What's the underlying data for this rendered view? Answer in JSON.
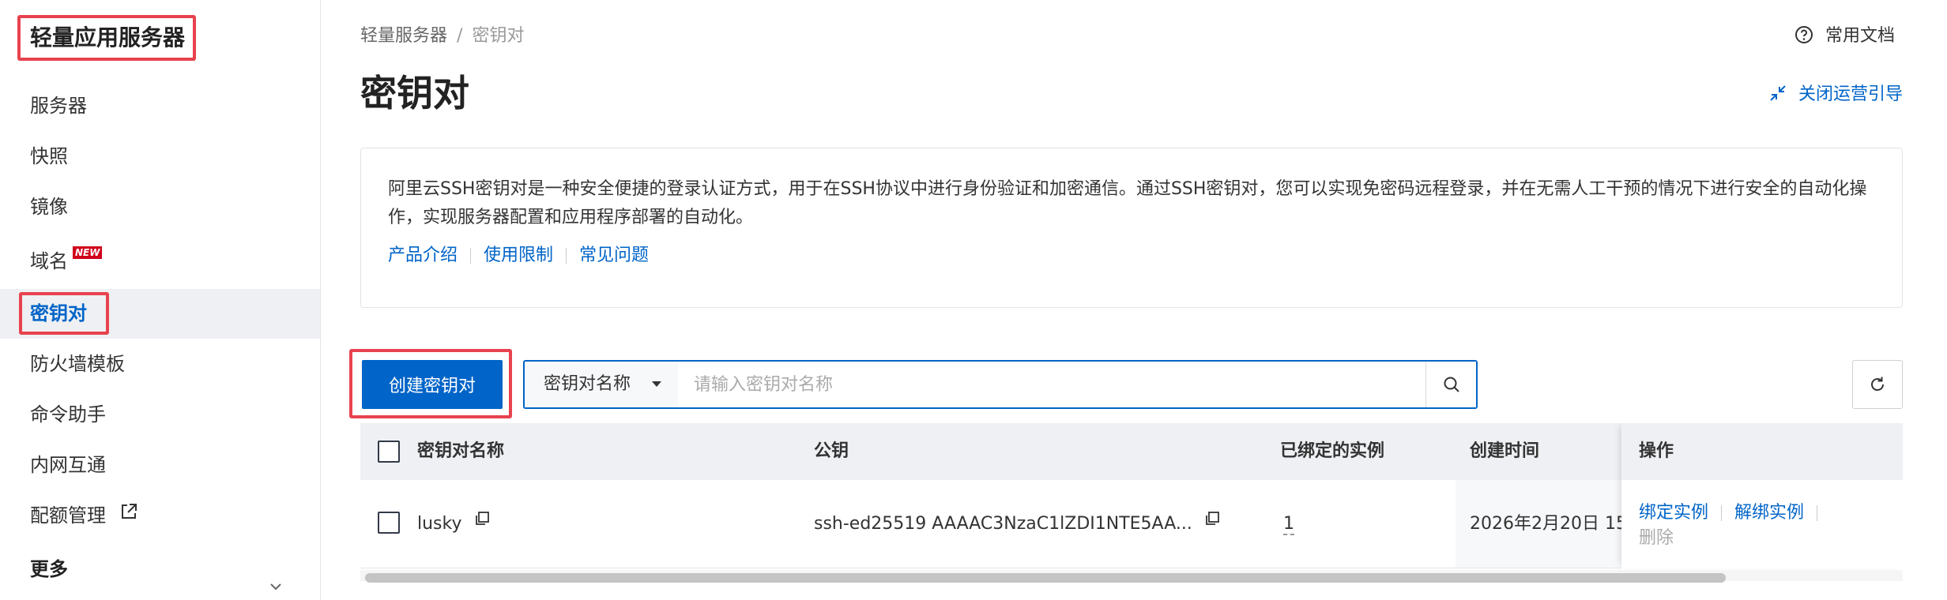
{
  "sidebar": {
    "title": "轻量应用服务器",
    "items": [
      {
        "label": "服务器"
      },
      {
        "label": "快照"
      },
      {
        "label": "镜像"
      },
      {
        "label": "域名",
        "badge": "NEW"
      },
      {
        "label": "密钥对"
      },
      {
        "label": "防火墙模板"
      },
      {
        "label": "命令助手"
      },
      {
        "label": "内网互通"
      },
      {
        "label": "配额管理"
      },
      {
        "label": "更多"
      }
    ]
  },
  "header": {
    "breadcrumb": {
      "parent": "轻量服务器",
      "separator": "/",
      "current": "密钥对"
    },
    "help_label": "常用文档",
    "title": "密钥对",
    "guide_label": "关闭运营引导"
  },
  "intro": {
    "text": "阿里云SSH密钥对是一种安全便捷的登录认证方式，用于在SSH协议中进行身份验证和加密通信。通过SSH密钥对，您可以实现免密码远程登录，并在无需人工干预的情况下进行安全的自动化操作，实现服务器配置和应用程序部署的自动化。",
    "links": [
      "产品介绍",
      "使用限制",
      "常见问题"
    ]
  },
  "toolbar": {
    "create_label": "创建密钥对",
    "search_field": "密钥对名称",
    "search_placeholder": "请输入密钥对名称"
  },
  "table": {
    "headers": {
      "name": "密钥对名称",
      "public_key": "公钥",
      "bound": "已绑定的实例",
      "created": "创建时间",
      "ops": "操作"
    },
    "rows": [
      {
        "name": "lusky",
        "public_key": "ssh-ed25519 AAAAC3NzaC1lZDI1NTE5AA...",
        "bound": "1",
        "created": "2026年2月20日 15",
        "ops": {
          "bind": "绑定实例",
          "unbind": "解绑实例",
          "delete": "删除"
        }
      }
    ]
  },
  "colors": {
    "accent": "#0064c8",
    "highlight": "#e8424f",
    "header_bg": "#eef0f3"
  }
}
